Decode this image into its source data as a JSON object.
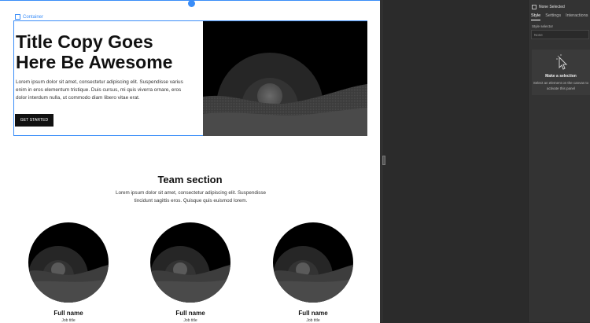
{
  "canvas": {
    "container_label": "Container",
    "hero": {
      "title": "Title Copy Goes Here Be Awesome",
      "text": "Lorem ipsum dolor sit amet, consectetur adipiscing elit. Suspendisse varius enim in eros elementum tristique. Duis cursus, mi quis viverra ornare, eros dolor interdum nulla, ut commodo diam libero vitae erat.",
      "button": "GET STARTED"
    },
    "team": {
      "title": "Team section",
      "text": "Lorem ipsum dolor sit amet, consectetur adipiscing elit. Suspendisse tincidunt sagittis eros. Quisque quis euismod lorem.",
      "members": [
        {
          "name": "Full name",
          "job": "Job title"
        },
        {
          "name": "Full name",
          "job": "Job title"
        },
        {
          "name": "Full name",
          "job": "Job title"
        }
      ]
    }
  },
  "panel": {
    "header": "None Selected",
    "tabs": [
      "Style",
      "Settings",
      "Interactions"
    ],
    "selector_label": "Style selector",
    "selector_value": "None",
    "empty_title": "Make a selection",
    "empty_text": "Select an element on the canvas to activate this panel"
  },
  "colors": {
    "selection": "#3a8df8",
    "panel_bg": "#333333",
    "canvas_bg": "#ffffff"
  }
}
